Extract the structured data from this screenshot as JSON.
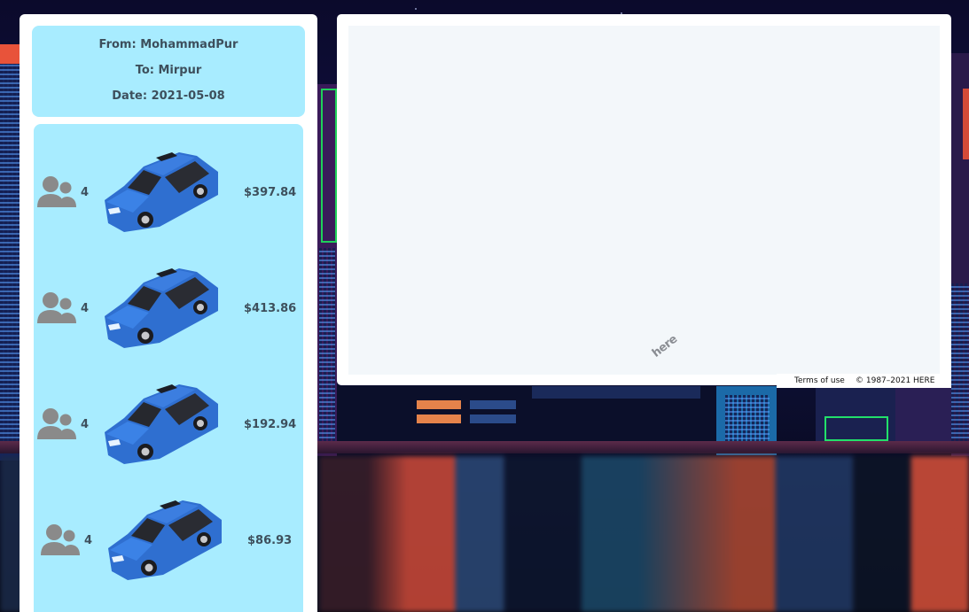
{
  "trip": {
    "from_label": "From: MohammadPur",
    "to_label": "To: Mirpur",
    "date_label": "Date: 2021-05-08"
  },
  "options": [
    {
      "passengers": "4",
      "price": "$397.84",
      "icon": "car-icon"
    },
    {
      "passengers": "4",
      "price": "$413.86",
      "icon": "car-icon"
    },
    {
      "passengers": "4",
      "price": "$192.94",
      "icon": "car-icon"
    },
    {
      "passengers": "4",
      "price": "$86.93",
      "icon": "car-icon"
    }
  ],
  "map": {
    "logo": "here",
    "terms_link": "Terms of use",
    "copyright": "© 1987–2021 HERE"
  },
  "colors": {
    "card_bg": "#a8ecff",
    "text": "#3d4f5c",
    "car_blue": "#2f6fd0",
    "icon_grey": "#8a8a8a"
  }
}
